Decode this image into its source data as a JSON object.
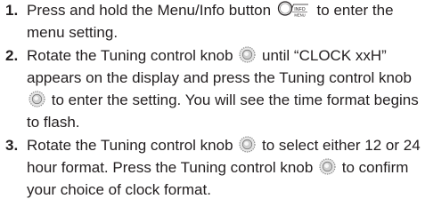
{
  "steps": [
    {
      "number": "1.",
      "text_a": "Press and hold the Menu/Info button",
      "icon_label_top": "INFO",
      "icon_label_bottom": "MENU",
      "text_b": "to enter the menu setting."
    },
    {
      "number": "2.",
      "text_a": "Rotate the Tuning control knob",
      "text_b": "until “CLOCK xxH” appears on the display and press the Tuning control knob",
      "text_c": "to enter the setting. You will see the time format begins to flash."
    },
    {
      "number": "3.",
      "text_a": "Rotate the Tuning control knob",
      "text_b": "to select either 12 or 24 hour format. Press the Tuning control knob",
      "text_c": "to confirm your choice of clock format."
    }
  ]
}
